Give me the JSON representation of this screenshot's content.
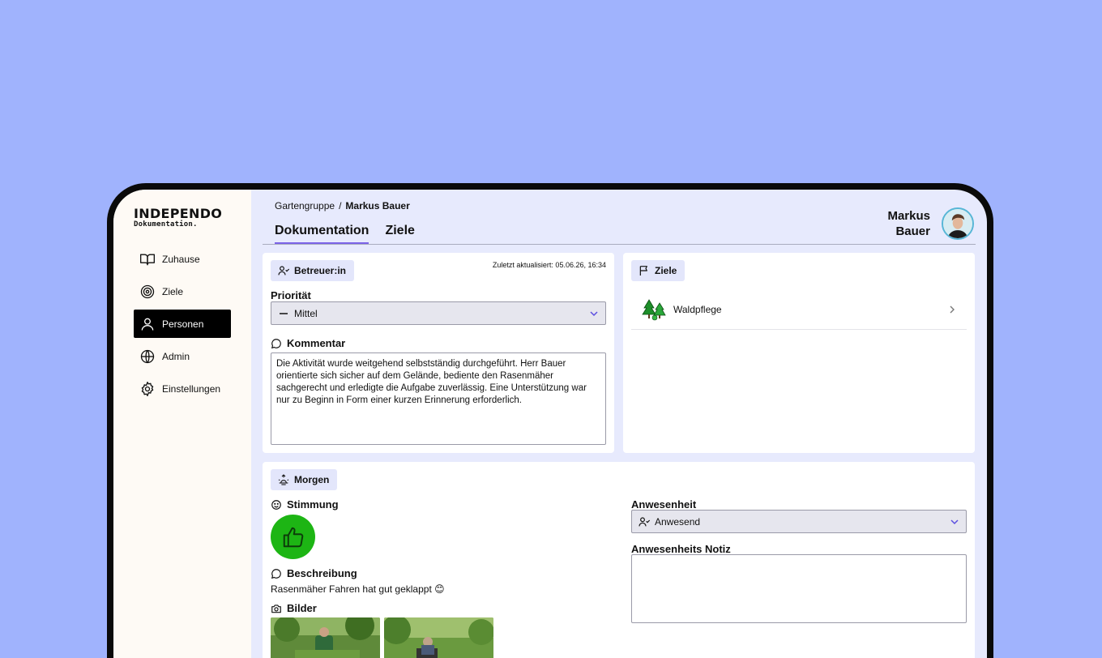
{
  "sidebar": {
    "logo_main": "INDEPENDO",
    "logo_sub": "Dokumentation.",
    "items": [
      {
        "label": "Zuhause",
        "icon": "book-icon",
        "active": false
      },
      {
        "label": "Ziele",
        "icon": "target-icon",
        "active": false
      },
      {
        "label": "Personen",
        "icon": "person-icon",
        "active": true
      },
      {
        "label": "Admin",
        "icon": "globe-icon",
        "active": false
      },
      {
        "label": "Einstellungen",
        "icon": "gear-icon",
        "active": false
      }
    ]
  },
  "header": {
    "breadcrumb": [
      "Gartengruppe",
      "Markus Bauer"
    ],
    "breadcrumb_sep": "/",
    "tabs": [
      {
        "label": "Dokumentation",
        "active": true
      },
      {
        "label": "Ziele",
        "active": false
      }
    ],
    "user_first": "Markus",
    "user_last": "Bauer"
  },
  "doc_card": {
    "chip": "Betreuer:in",
    "updated": "Zuletzt aktualisiert: 05.06.26, 16:34",
    "priority_label": "Priorität",
    "priority_value": "Mittel",
    "comment_label": "Kommentar",
    "comment_text": "Die Aktivität wurde weitgehend selbstständig durchgeführt. Herr Bauer orientierte sich sicher auf dem Gelände, bediente den Rasenmäher sachgerecht und erledigte die Aufgabe zuverlässig. Eine Unterstützung war nur zu Beginn in Form einer kurzen Erinnerung erforderlich."
  },
  "goals_card": {
    "chip": "Ziele",
    "goals": [
      {
        "name": "Waldpflege",
        "icon": "trees-icon"
      }
    ]
  },
  "morning_card": {
    "chip": "Morgen",
    "mood_label": "Stimmung",
    "mood_icon": "thumbs-up-icon",
    "description_label": "Beschreibung",
    "description_text": "Rasenmäher Fahren hat gut geklappt 😊",
    "photos_label": "Bilder",
    "attendance_label": "Anwesenheit",
    "attendance_value": "Anwesend",
    "attendance_note_label": "Anwesenheits Notiz",
    "attendance_note_value": ""
  },
  "colors": {
    "background": "#a0b3fd",
    "accent": "#7b63e8",
    "mood_green": "#1db514",
    "chip_bg": "#e3e6fb"
  }
}
